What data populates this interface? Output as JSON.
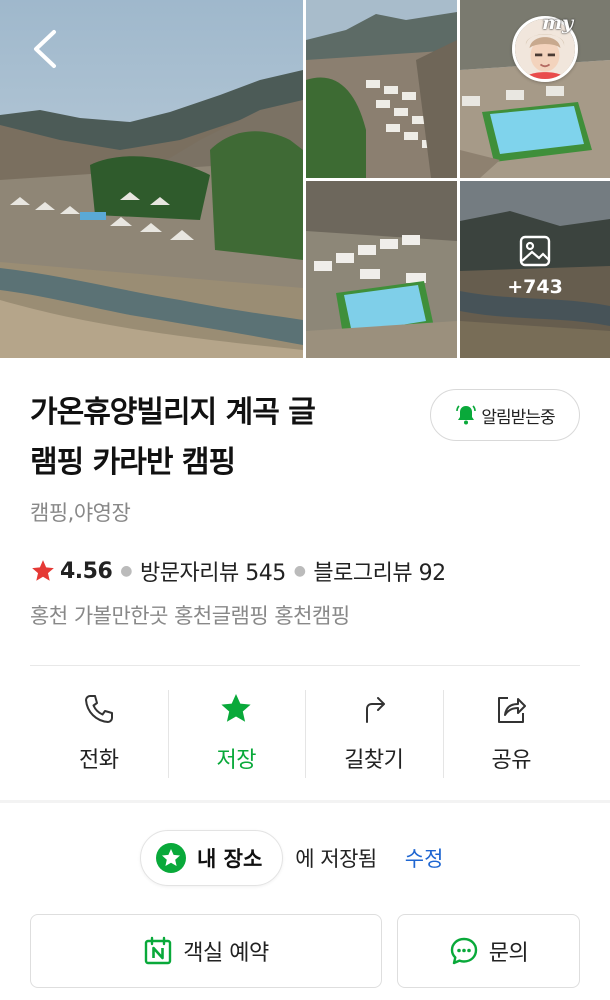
{
  "photos": {
    "more_count": "+743",
    "my_label": "my"
  },
  "place": {
    "title_line1": "가온휴양빌리지 계곡 글",
    "title_line2": "램핑 카라반 캠핑",
    "category": "캠핑,야영장",
    "rating": "4.56",
    "visitor_reviews": "방문자리뷰 545",
    "blog_reviews": "블로그리뷰 92",
    "tags": "홍천 가볼만한곳 홍천글램핑 홍천캠핑"
  },
  "alarm": {
    "label": "알림받는중"
  },
  "actions": [
    {
      "label": "전화",
      "icon": "phone-icon"
    },
    {
      "label": "저장",
      "icon": "star-icon"
    },
    {
      "label": "길찾기",
      "icon": "directions-icon"
    },
    {
      "label": "공유",
      "icon": "share-icon"
    }
  ],
  "saved": {
    "folder": "내 장소",
    "text": "에 저장됨",
    "edit": "수정"
  },
  "buttons": {
    "reserve": "객실 예약",
    "inquiry": "문의"
  },
  "colors": {
    "accent_green": "#09a93a",
    "link_blue": "#1f66d1",
    "rating_star": "#e53935"
  }
}
